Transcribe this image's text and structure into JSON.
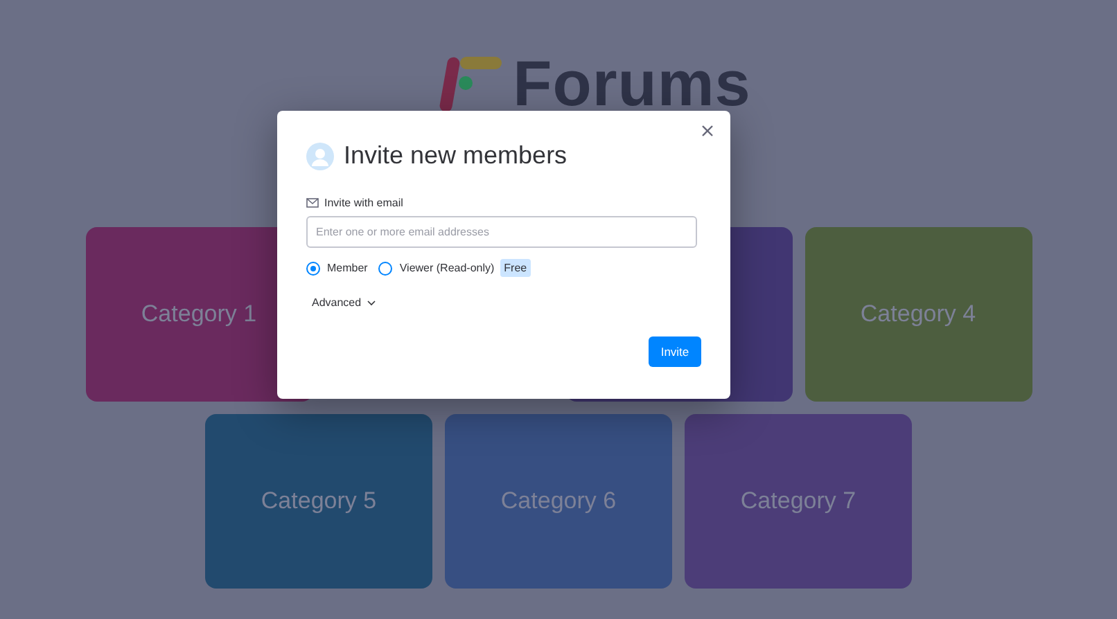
{
  "logo": {
    "text": "Forums"
  },
  "categories": [
    {
      "label": "Category 1",
      "color": "#6a2a5e"
    },
    {
      "color": "#413672"
    },
    {
      "label": "Category 4",
      "color": "#4d5e3f"
    },
    {
      "label": "Category 5",
      "color": "#224a6e"
    },
    {
      "label": "Category 6",
      "color": "#374f82"
    },
    {
      "label": "Category 7",
      "color": "#4c3d78"
    }
  ],
  "dialog": {
    "title": "Invite new members",
    "section_label": "Invite with email",
    "email": {
      "placeholder": "Enter one or more email addresses"
    },
    "roles": [
      {
        "label": "Member",
        "selected": true
      },
      {
        "label": "Viewer (Read-only)",
        "selected": false,
        "badge": "Free"
      }
    ],
    "advanced": {
      "label": "Advanced",
      "expanded": false
    },
    "submit": "Invite"
  }
}
